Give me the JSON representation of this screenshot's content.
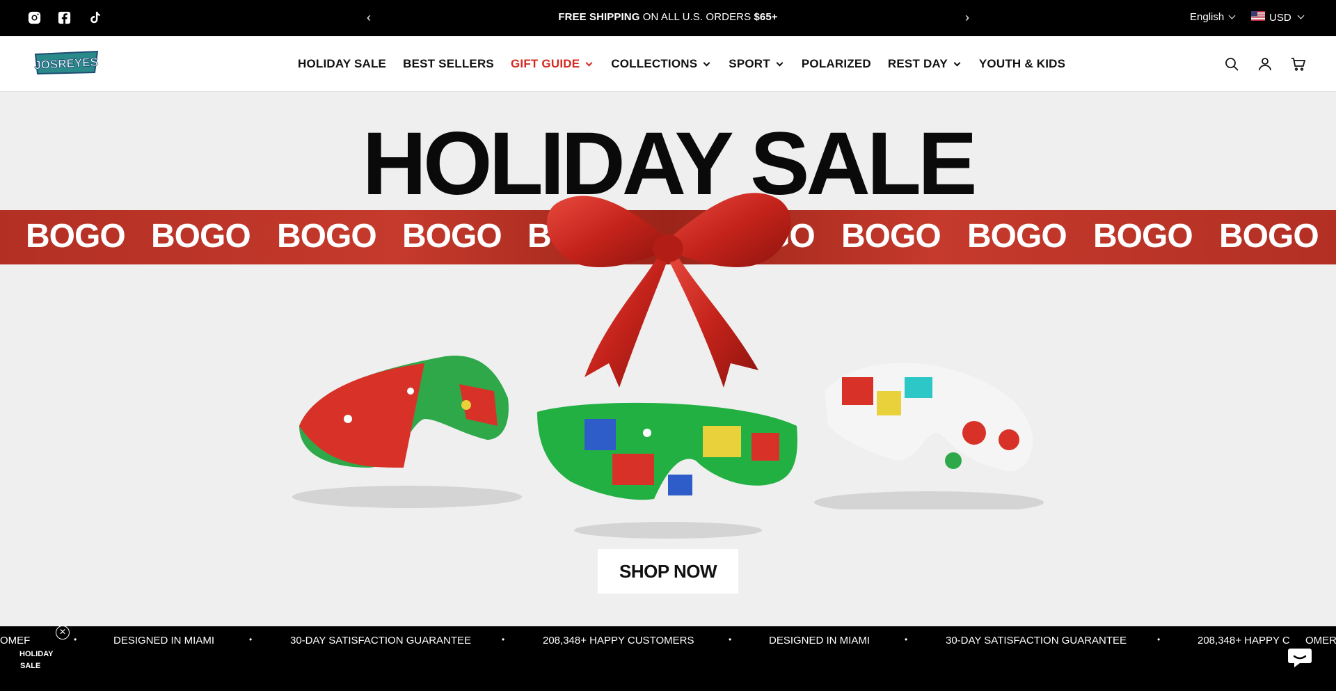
{
  "topbar": {
    "announcement_bold": "FREE SHIPPING",
    "announcement_mid": " ON ALL U.S. ORDERS ",
    "announcement_amount": "$65+",
    "language": "English",
    "currency": "USD",
    "social_icons": [
      "instagram-icon",
      "facebook-icon",
      "tiktok-icon"
    ]
  },
  "header": {
    "logo_text": "JOSREYES",
    "nav": [
      {
        "label": "HOLIDAY SALE",
        "dropdown": false
      },
      {
        "label": "BEST SELLERS",
        "dropdown": false
      },
      {
        "label": "GIFT GUIDE",
        "dropdown": true,
        "highlight": true
      },
      {
        "label": "COLLECTIONS",
        "dropdown": true
      },
      {
        "label": "SPORT",
        "dropdown": true
      },
      {
        "label": "POLARIZED",
        "dropdown": false
      },
      {
        "label": "REST DAY",
        "dropdown": true
      },
      {
        "label": "YOUTH & KIDS",
        "dropdown": false
      }
    ],
    "icons": [
      "search-icon",
      "account-icon",
      "cart-icon"
    ]
  },
  "hero": {
    "title": "HOLIDAY SALE",
    "ribbon_word": "BOGO",
    "cta": "SHOP NOW",
    "accent_color": "#c0392b"
  },
  "ticker": {
    "items": [
      "OMEF",
      "DESIGNED IN MIAMI",
      "30-DAY SATISFACTION GUARANTEE",
      "208,348+ HAPPY CUSTOMERS",
      "DESIGNED IN MIAMI",
      "30-DAY SATISFACTION GUARANTEE",
      "208,348+ HAPPY C",
      "OMER"
    ]
  },
  "badge": {
    "line1": "HOLIDAY",
    "line2": "SALE"
  }
}
